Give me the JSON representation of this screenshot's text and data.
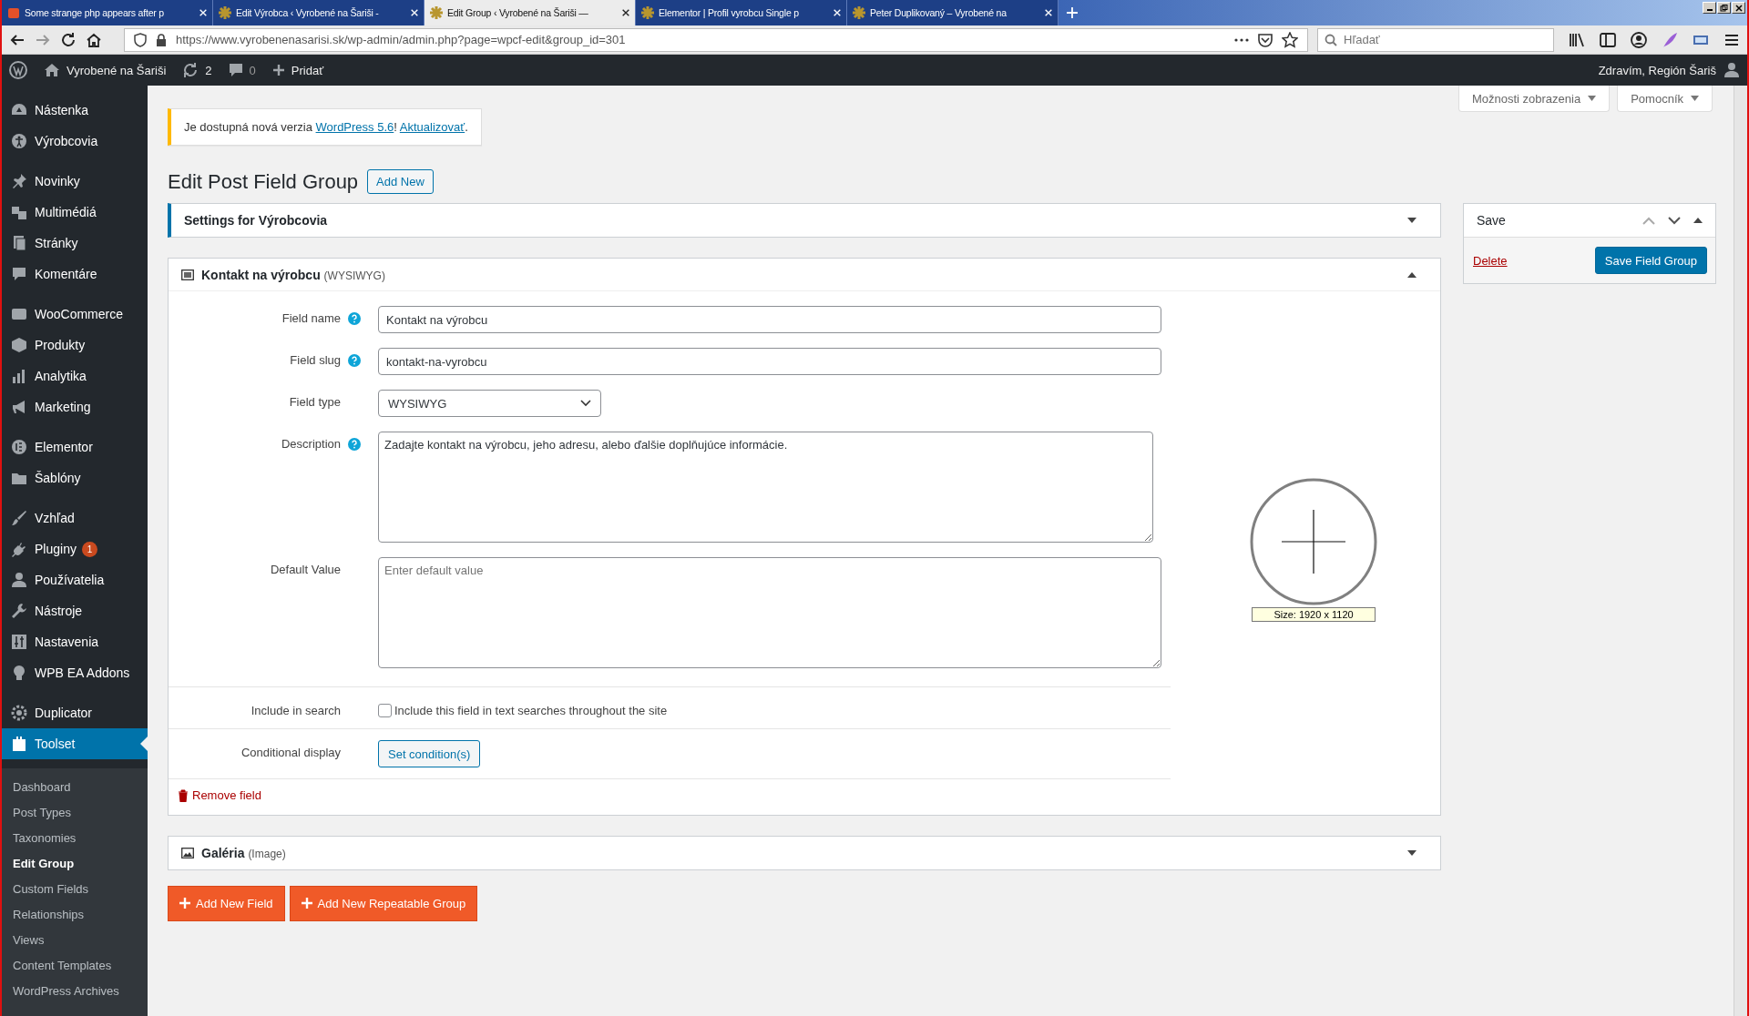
{
  "browser": {
    "tabs": [
      {
        "title": "Some strange php appears after p",
        "selected": false
      },
      {
        "title": "Edit Výrobca ‹ Vyrobené na Šariši -",
        "selected": false
      },
      {
        "title": "Edit Group ‹ Vyrobené na Šariši —",
        "selected": true
      },
      {
        "title": "Elementor | Profil vyrobcu Single p",
        "selected": false
      },
      {
        "title": "Peter Duplikovaný – Vyrobené na",
        "selected": false
      }
    ],
    "url": "https://www.vyrobenenasarisi.sk/wp-admin/admin.php?page=wpcf-edit&group_id=301",
    "search": {
      "placeholder": "Hľadať"
    }
  },
  "admin_bar": {
    "site": "Vyrobené na Šariši",
    "updates": "2",
    "comments": "0",
    "new": "Pridať",
    "greeting": "Zdravím, Región Šariš"
  },
  "sidebar": {
    "groups": [
      [
        {
          "label": "Nástenka",
          "selected": false
        },
        {
          "label": "Výrobcovia",
          "selected": false
        }
      ],
      [
        {
          "label": "Novinky",
          "selected": false
        },
        {
          "label": "Multimédiá",
          "selected": false
        },
        {
          "label": "Stránky",
          "selected": false
        },
        {
          "label": "Komentáre",
          "selected": false
        }
      ],
      [
        {
          "label": "WooCommerce",
          "selected": false
        },
        {
          "label": "Produkty",
          "selected": false
        },
        {
          "label": "Analytika",
          "selected": false
        },
        {
          "label": "Marketing",
          "selected": false
        }
      ],
      [
        {
          "label": "Elementor",
          "selected": false
        },
        {
          "label": "Šablóny",
          "selected": false
        }
      ],
      [
        {
          "label": "Vzhľad",
          "selected": false
        },
        {
          "label": "Pluginy",
          "selected": false,
          "badge": "1"
        },
        {
          "label": "Používatelia",
          "selected": false
        },
        {
          "label": "Nástroje",
          "selected": false
        },
        {
          "label": "Nastavenia",
          "selected": false
        },
        {
          "label": "WPB EA Addons",
          "selected": false
        }
      ],
      [
        {
          "label": "Duplicator",
          "selected": false
        },
        {
          "label": "Toolset",
          "selected": true
        }
      ]
    ],
    "submenu": [
      {
        "label": "Dashboard",
        "selected": false
      },
      {
        "label": "Post Types",
        "selected": false
      },
      {
        "label": "Taxonomies",
        "selected": false
      },
      {
        "label": "Edit Group",
        "selected": true
      },
      {
        "label": "Custom Fields",
        "selected": false
      },
      {
        "label": "Relationships",
        "selected": false
      },
      {
        "label": "Views",
        "selected": false
      },
      {
        "label": "Content Templates",
        "selected": false
      },
      {
        "label": "WordPress Archives",
        "selected": false
      }
    ]
  },
  "screen_buttons": [
    "Možnosti zobrazenia",
    "Pomocník"
  ],
  "notice": {
    "parts": [
      {
        "kind": "text",
        "text": "Je dostupná nová verzia "
      },
      {
        "kind": "link",
        "text": "WordPress 5.6"
      },
      {
        "kind": "text",
        "text": "! "
      },
      {
        "kind": "link",
        "text": "Aktualizovať"
      },
      {
        "kind": "text",
        "text": "."
      }
    ]
  },
  "page": {
    "title": "Edit Post Field Group",
    "add_new": "Add New"
  },
  "settings_box": {
    "title": "Settings for Výrobcovia",
    "expanded": false
  },
  "field": {
    "name": "Kontakt na výrobcu",
    "type": "(WYSIWYG)",
    "expanded": true,
    "rows": [
      {
        "kind": "input",
        "label": "Field name",
        "help": true,
        "value": "Kontakt na výrobcu"
      },
      {
        "kind": "input",
        "label": "Field slug",
        "help": true,
        "value": "kontakt-na-vyrobcu"
      },
      {
        "kind": "select",
        "label": "Field type",
        "help": false,
        "value": "WYSIWYG"
      },
      {
        "kind": "textarea",
        "label": "Description",
        "help": true,
        "value": "Zadajte kontakt na výrobcu, jeho adresu, alebo ďalšie doplňujúce informácie."
      },
      {
        "kind": "textarea",
        "label": "Default Value",
        "help": false,
        "placeholder": "Enter default value"
      },
      {
        "kind": "checkbox",
        "label": "Include in search",
        "help": false,
        "text": "Include this field in text searches throughout the site",
        "checked": false
      },
      {
        "kind": "button",
        "label": "Conditional display",
        "help": false,
        "button": "Set condition(s)"
      }
    ],
    "remove": "Remove field"
  },
  "gallery_box": {
    "name": "Galéria",
    "type": "(Image)",
    "expanded": false
  },
  "add_buttons": [
    "Add New Field",
    "Add New Repeatable Group"
  ],
  "save_box": {
    "title": "Save",
    "expanded": true,
    "delete": "Delete",
    "save": "Save Field Group"
  },
  "overlay": {
    "size": "Size: 1920 x 1120"
  }
}
